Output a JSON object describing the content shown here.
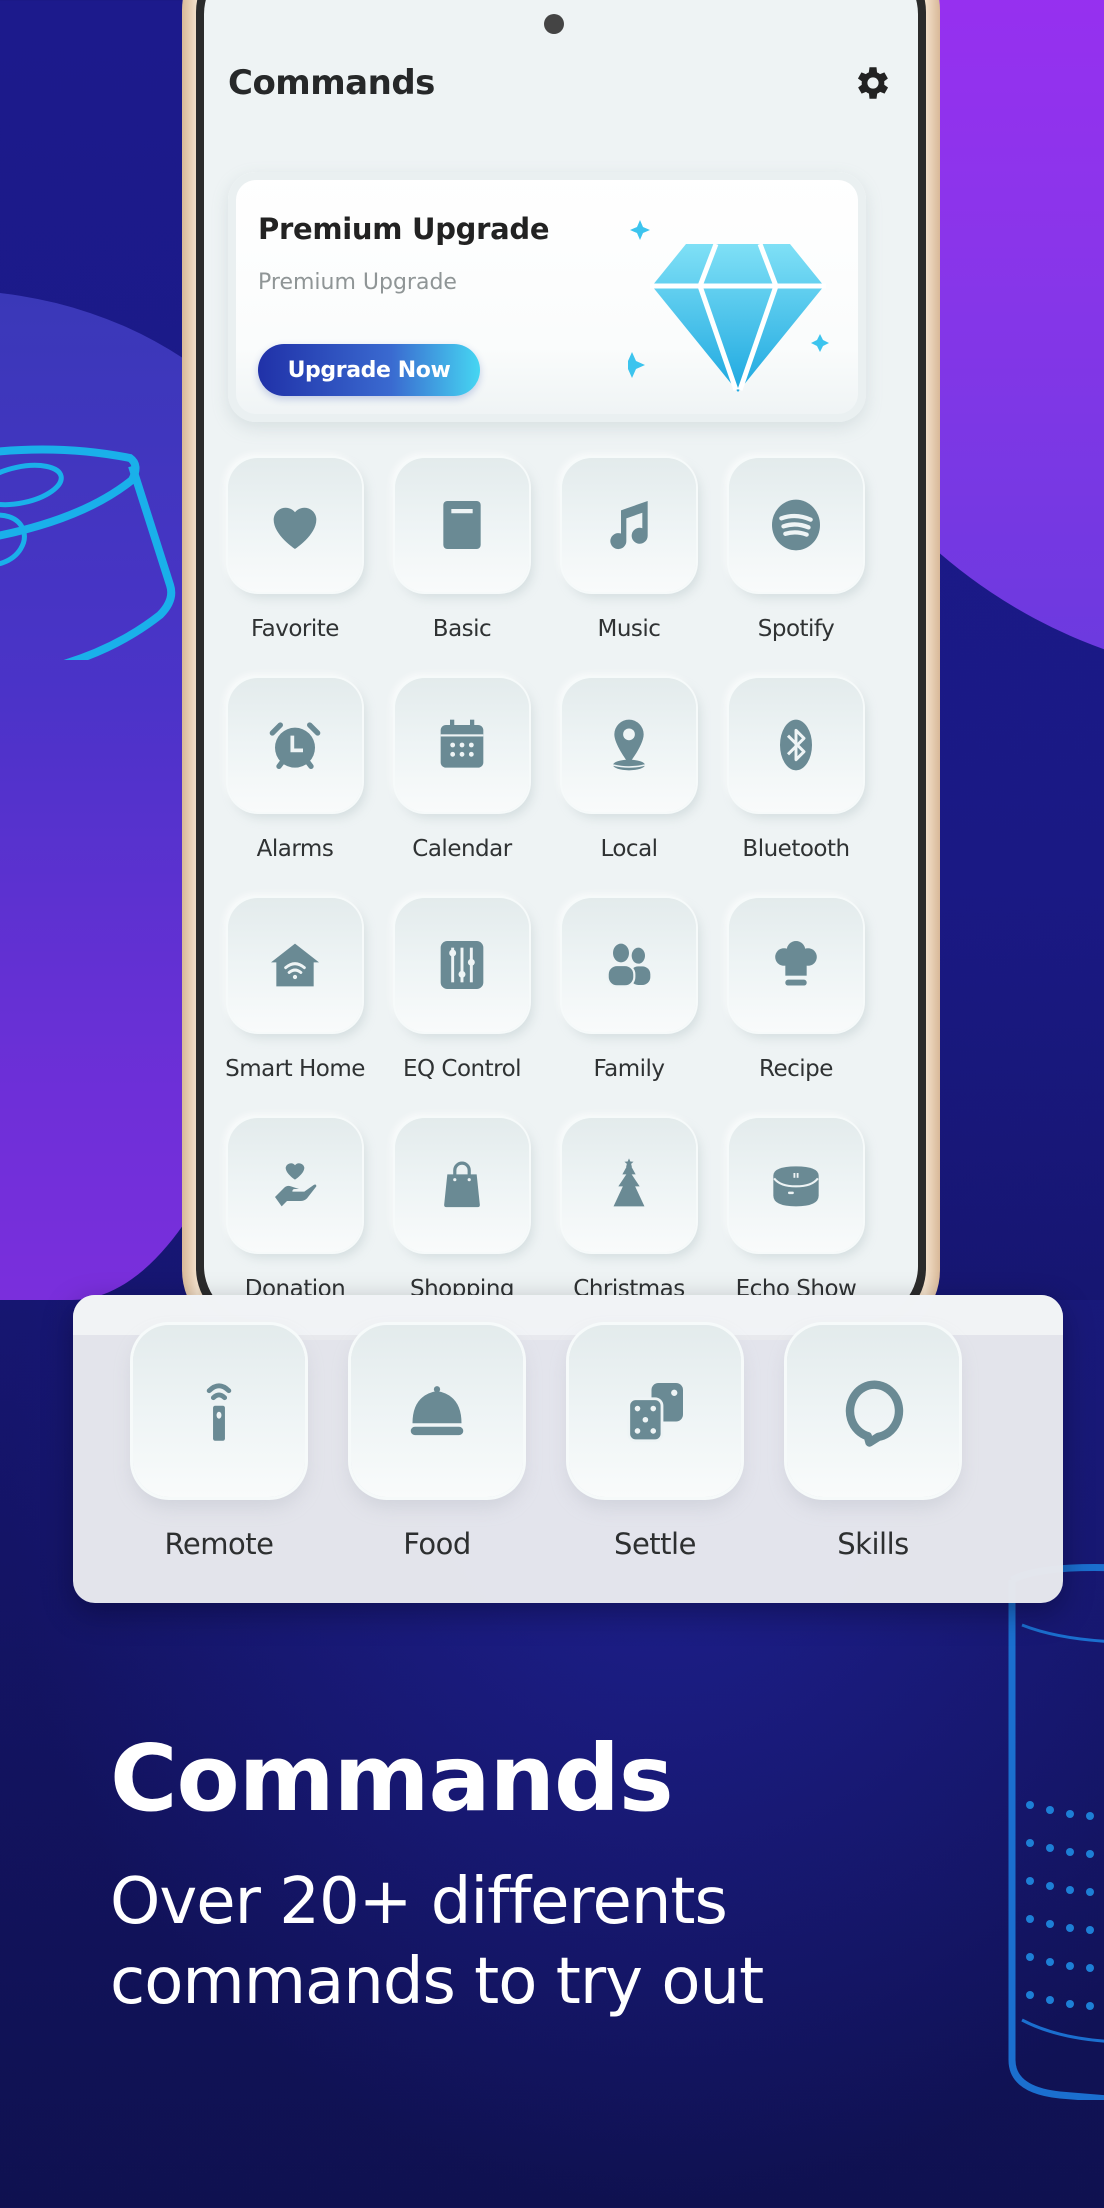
{
  "app": {
    "title": "Commands",
    "settings_icon": "gear-icon"
  },
  "premium": {
    "title": "Premium Upgrade",
    "subtitle": "Premium Upgrade",
    "button_label": "Upgrade Now",
    "icon": "diamond-icon"
  },
  "commands": [
    {
      "label": "Favorite",
      "icon": "heart-icon"
    },
    {
      "label": "Basic",
      "icon": "book-icon"
    },
    {
      "label": "Music",
      "icon": "music-note-icon"
    },
    {
      "label": "Spotify",
      "icon": "spotify-icon"
    },
    {
      "label": "Alarms",
      "icon": "alarm-clock-icon"
    },
    {
      "label": "Calendar",
      "icon": "calendar-icon"
    },
    {
      "label": "Local",
      "icon": "location-pin-icon"
    },
    {
      "label": "Bluetooth",
      "icon": "bluetooth-icon"
    },
    {
      "label": "Smart Home",
      "icon": "smart-home-icon"
    },
    {
      "label": "EQ Control",
      "icon": "equalizer-icon"
    },
    {
      "label": "Family",
      "icon": "family-icon"
    },
    {
      "label": "Recipe",
      "icon": "chef-hat-icon"
    },
    {
      "label": "Donation",
      "icon": "donation-hand-icon"
    },
    {
      "label": "Shopping",
      "icon": "shopping-bag-icon"
    },
    {
      "label": "Christmas",
      "icon": "christmas-tree-icon"
    },
    {
      "label": "Echo Show",
      "icon": "echo-device-icon"
    }
  ],
  "featured": [
    {
      "label": "Remote",
      "icon": "remote-icon"
    },
    {
      "label": "Food",
      "icon": "food-cloche-icon"
    },
    {
      "label": "Settle",
      "icon": "dice-icon"
    },
    {
      "label": "Skills",
      "icon": "alexa-ring-icon"
    }
  ],
  "promo": {
    "headline": "Commands",
    "subline": "Over 20+  differents\ncommands to try out"
  },
  "colors": {
    "icon": "#6a8a94",
    "accent_gradient_start": "#2031a8",
    "accent_gradient_end": "#46d6f2",
    "background": "#1a1984",
    "purple": "#a02cf4",
    "decor_stroke": "#1ab0ea"
  }
}
